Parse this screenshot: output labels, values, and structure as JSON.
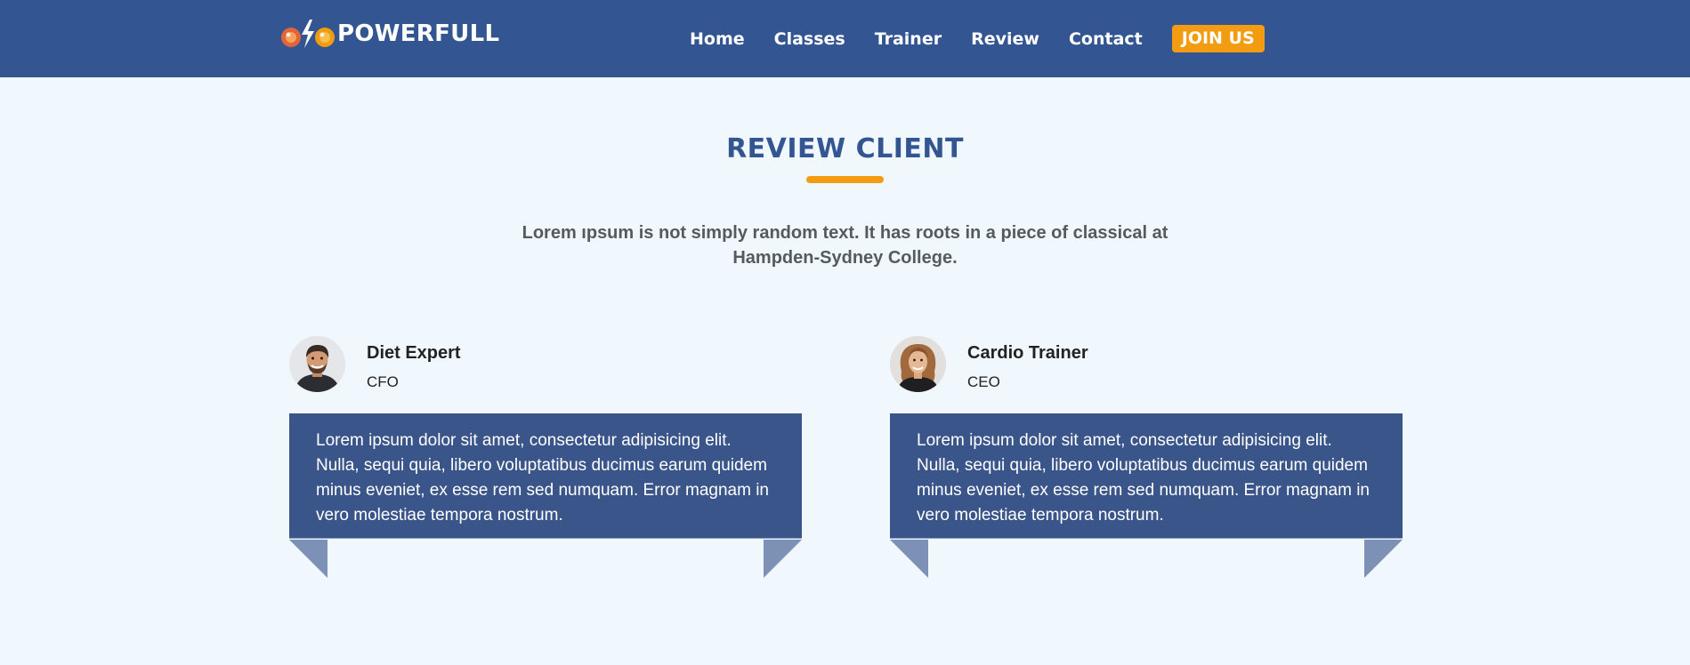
{
  "brand": {
    "name": "POWERFULL",
    "logo_icon": "dumbbell-bolt-icon",
    "colors": {
      "primary": "#335591",
      "accent": "#f39c12",
      "card": "#3a5589",
      "fold": "#7d90b6",
      "background": "#f0f7fd"
    }
  },
  "nav": {
    "links": [
      "Home",
      "Classes",
      "Trainer",
      "Review",
      "Contact"
    ],
    "cta": "JOIN US"
  },
  "section": {
    "title": "REVIEW CLIENT",
    "description": "Lorem ıpsum is not simply random text. It has roots in a piece of classical at Hampden-Sydney College."
  },
  "reviews": [
    {
      "name": "Diet Expert",
      "role": "CFO",
      "avatar": "male-avatar",
      "text": "Lorem ipsum dolor sit amet, consectetur adipisicing elit. Nulla, sequi quia, libero voluptatibus ducimus earum quidem minus eveniet, ex esse rem sed numquam. Error magnam in vero molestiae tempora nostrum."
    },
    {
      "name": "Cardio Trainer",
      "role": "CEO",
      "avatar": "female-avatar",
      "text": "Lorem ipsum dolor sit amet, consectetur adipisicing elit. Nulla, sequi quia, libero voluptatibus ducimus earum quidem minus eveniet, ex esse rem sed numquam. Error magnam in vero molestiae tempora nostrum."
    }
  ]
}
